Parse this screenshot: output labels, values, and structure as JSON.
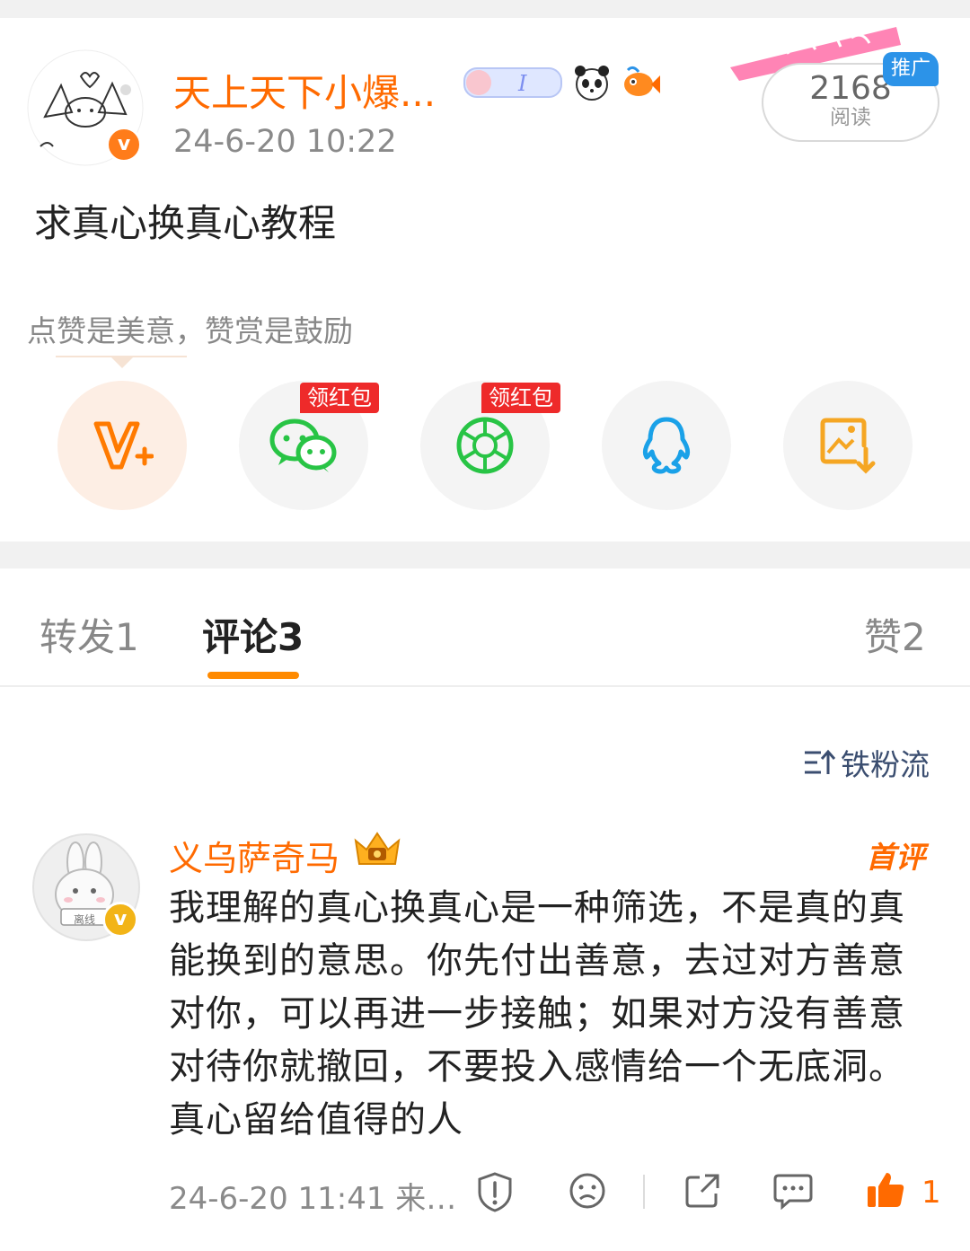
{
  "post": {
    "username": "天上天下小爆...",
    "time": "24-6-20 10:22",
    "read_count": "2168",
    "read_label": "阅读",
    "promo_label": "推广",
    "content": "求真心换真心教程",
    "praise_hint": "点赞是美意，赞赏是鼓励"
  },
  "share": {
    "red_packet_label": "领红包"
  },
  "tabs": {
    "repost": "转发1",
    "comment": "评论3",
    "like": "赞2"
  },
  "sort": {
    "label": "铁粉流"
  },
  "comment": {
    "username": "义乌萨奇马",
    "first_badge": "首评",
    "text": "我理解的真心换真心是一种筛选，不是真的真能换到的意思。你先付出善意，去过对方善意对你，可以再进一步接触；如果对方没有善意对待你就撤回，不要投入感情给一个无底洞。真心留给值得的人",
    "time": "24-6-20 11:41  来…",
    "like_count": "1",
    "avatar_tag": "离线"
  },
  "colors": {
    "accent": "#ff6a00",
    "tab_underline": "#ff8a00",
    "wechat": "#28c445",
    "qq": "#1aa1e8",
    "promo": "#2c93e8",
    "red_tag": "#ee2a2a"
  },
  "icons": [
    "v-plus-icon",
    "wechat-icon",
    "moments-icon",
    "qq-icon",
    "save-image-icon",
    "sort-icon",
    "report-icon",
    "dislike-icon",
    "share-icon",
    "comment-icon",
    "like-icon"
  ]
}
